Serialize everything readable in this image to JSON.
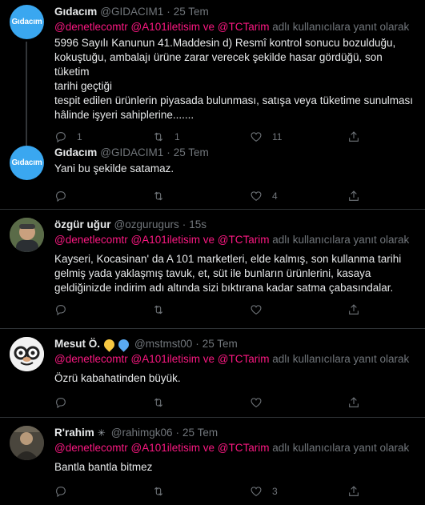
{
  "tweets": [
    {
      "avatar_text": "Gıdacım",
      "name": "Gıdacım",
      "handle": "@GIDACIM1",
      "time": "25 Tem",
      "reply_prefix": "",
      "reply_mentions": "@denetlecomtr @A101iletisim ve @TCTarim",
      "reply_suffix": "adlı kullanıcılara yanıt olarak",
      "text_lines": [
        "5996 Sayılı Kanunun 41.Maddesin d) Resmî kontrol sonucu bozulduğu,",
        "kokuştuğu, ambalajı ürüne zarar verecek şekilde hasar gördüğü, son tüketim",
        "tarihi geçtiği",
        "tespit edilen ürünlerin piyasada bulunması, satışa veya tüketime sunulması",
        "hâlinde işyeri sahiplerine......."
      ],
      "replies": "1",
      "retweets": "1",
      "likes": "11"
    },
    {
      "avatar_text": "Gıdacım",
      "name": "Gıdacım",
      "handle": "@GIDACIM1",
      "time": "25 Tem",
      "text_lines": [
        "Yani bu şekilde satamaz."
      ],
      "replies": "",
      "retweets": "",
      "likes": "4"
    },
    {
      "name": "özgür uğur",
      "handle": "@ozgurugurs",
      "time": "15s",
      "reply_mentions": "@denetlecomtr @A101iletisim ve @TCTarim",
      "reply_suffix": "adlı kullanıcılara yanıt olarak",
      "text_lines": [
        "Kayseri, Kocasinan' da A 101 marketleri, elde kalmış, son kullanma tarihi",
        "gelmiş yada yaklaşmış tavuk, et, süt ile bunların ürünlerini, kasaya",
        "geldiğinizde indirim adı altında sizi bıktırana kadar satma çabasındalar."
      ],
      "replies": "",
      "retweets": "",
      "likes": ""
    },
    {
      "name": "Mesut Ö.",
      "handle": "@mstmst00",
      "time": "25 Tem",
      "reply_mentions": "@denetlecomtr @A101iletisim ve @TCTarim",
      "reply_suffix": "adlı kullanıcılara yanıt olarak",
      "text_lines": [
        "Özrü kabahatinden büyük."
      ],
      "replies": "",
      "retweets": "",
      "likes": ""
    },
    {
      "name": "R'rahim",
      "handle": "@rahimgk06",
      "time": "25 Tem",
      "reply_mentions": "@denetlecomtr @A101iletisim ve @TCTarim",
      "reply_suffix": "adlı kullanıcılara yanıt olarak",
      "text_lines": [
        "Bantla bantla bitmez"
      ],
      "replies": "",
      "retweets": "",
      "likes": "3"
    }
  ],
  "separator": "·",
  "colors": {
    "background": "#000000",
    "mention": "#f91880",
    "muted": "#71767b",
    "avatar_blue": "#3aa7f0"
  }
}
